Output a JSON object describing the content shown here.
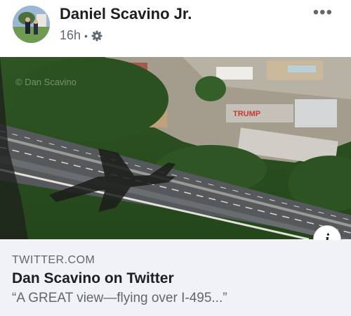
{
  "post": {
    "author": "Daniel Scavino Jr.",
    "time": "16h",
    "separator": "•",
    "privacy_icon": "gear-icon",
    "more_icon": "more-options-icon",
    "more_label": "•••"
  },
  "image": {
    "watermark": "© Dan Scavino",
    "roof_sign": "TRUMP"
  },
  "info_button": {
    "label": "i"
  },
  "link": {
    "domain": "TWITTER.COM",
    "title": "Dan Scavino on Twitter",
    "description": "“A GREAT view—flying over I-495...”"
  }
}
